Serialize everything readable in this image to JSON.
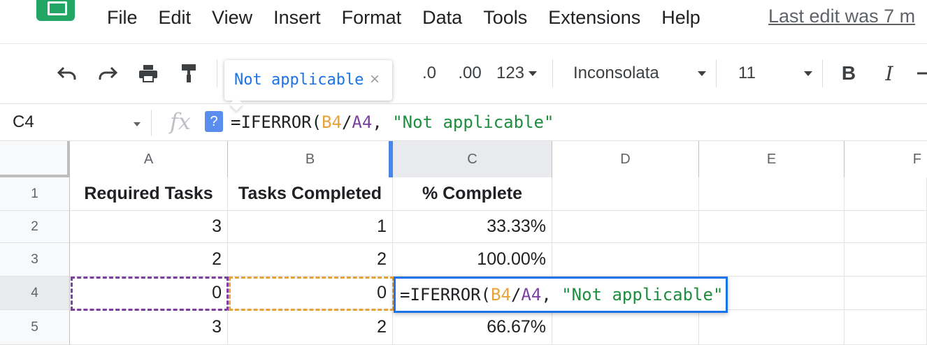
{
  "menu": {
    "items": [
      "File",
      "Edit",
      "View",
      "Insert",
      "Format",
      "Data",
      "Tools",
      "Extensions",
      "Help"
    ],
    "last_edit": "Last edit was 7 m"
  },
  "toolbar": {
    "undo_icon": "undo-icon",
    "redo_icon": "redo-icon",
    "print_icon": "print-icon",
    "paint_format_icon": "paint-format-icon",
    "decrease_decimal": ".0",
    "increase_decimal": ".00",
    "more_formats": "123",
    "font": "Inconsolata",
    "font_size": "11",
    "bold": "B",
    "italic": "I"
  },
  "tooltip": {
    "text": "Not applicable",
    "close": "×"
  },
  "formula_bar": {
    "cell_ref": "C4",
    "fx": "fx",
    "help": "?",
    "formula_prefix": "=IFERROR(",
    "ref1": "B4",
    "slash": "/",
    "ref2": "A4",
    "comma": ", ",
    "string": "\"Not applicable\""
  },
  "sheet": {
    "columns": [
      "A",
      "B",
      "C",
      "D",
      "E",
      "F"
    ],
    "rows": [
      "1",
      "2",
      "3",
      "4",
      "5"
    ],
    "cells": {
      "A1": "Required Tasks",
      "B1": "Tasks Completed",
      "C1": "% Complete",
      "A2": "3",
      "B2": "1",
      "C2": "33.33%",
      "A3": "2",
      "B3": "2",
      "C3": "100.00%",
      "A4": "0",
      "B4": "0",
      "A5": "3",
      "B5": "2",
      "C5": "66.67%"
    },
    "active_cell": "C4"
  },
  "colors": {
    "accent": "#1a73e8",
    "ref_b4": "#e8a23b",
    "ref_a4": "#7b3fa0",
    "string": "#1e8e3e"
  }
}
